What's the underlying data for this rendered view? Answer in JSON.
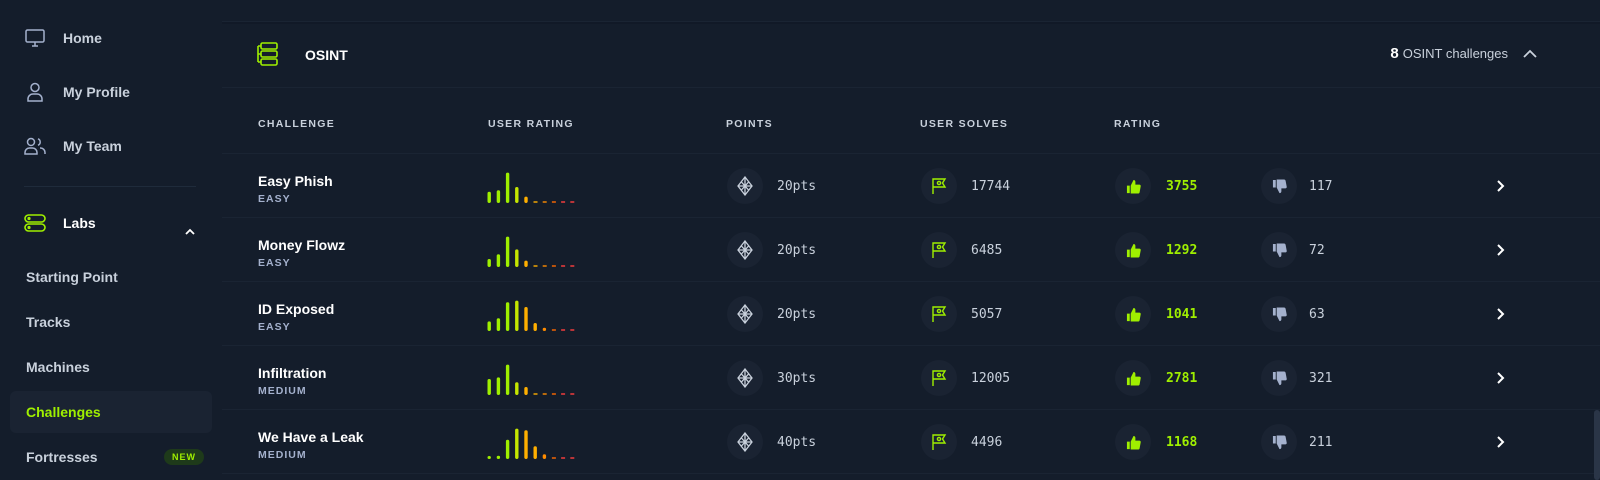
{
  "sidebar": {
    "nav": [
      {
        "label": "Home",
        "icon": "monitor-icon"
      },
      {
        "label": "My Profile",
        "icon": "user-icon"
      },
      {
        "label": "My Team",
        "icon": "team-icon"
      },
      {
        "label": "Labs",
        "icon": "labs-icon"
      }
    ],
    "sub": [
      {
        "label": "Starting Point"
      },
      {
        "label": "Tracks"
      },
      {
        "label": "Machines"
      },
      {
        "label": "Challenges",
        "active": true
      },
      {
        "label": "Fortresses",
        "badge": "NEW"
      }
    ]
  },
  "section": {
    "title": "OSINT",
    "count": "8",
    "count_label": "OSINT challenges"
  },
  "columns": [
    "CHALLENGE",
    "USER RATING",
    "POINTS",
    "USER SOLVES",
    "RATING"
  ],
  "rows": [
    {
      "name": "Easy Phish",
      "difficulty": "EASY",
      "points": "20pts",
      "solves": "17744",
      "likes": "3755",
      "dislikes": "117",
      "bars": [
        0.35,
        0.4,
        0.95,
        0.5,
        0.2,
        0.05,
        0.05,
        0.05,
        0.05,
        0.05
      ]
    },
    {
      "name": "Money Flowz",
      "difficulty": "EASY",
      "points": "20pts",
      "solves": "6485",
      "likes": "1292",
      "dislikes": "72",
      "bars": [
        0.25,
        0.4,
        0.95,
        0.55,
        0.2,
        0.05,
        0.05,
        0.05,
        0.05,
        0.05
      ]
    },
    {
      "name": "ID Exposed",
      "difficulty": "EASY",
      "points": "20pts",
      "solves": "5057",
      "likes": "1041",
      "dislikes": "63",
      "bars": [
        0.3,
        0.4,
        0.9,
        0.95,
        0.75,
        0.25,
        0.1,
        0.05,
        0.05,
        0.05
      ]
    },
    {
      "name": "Infiltration",
      "difficulty": "MEDIUM",
      "points": "30pts",
      "solves": "12005",
      "likes": "2781",
      "dislikes": "321",
      "bars": [
        0.5,
        0.55,
        0.95,
        0.4,
        0.25,
        0.05,
        0.05,
        0.05,
        0.05,
        0.05
      ]
    },
    {
      "name": "We Have a Leak",
      "difficulty": "MEDIUM",
      "points": "40pts",
      "solves": "4496",
      "likes": "1168",
      "dislikes": "211",
      "bars": [
        0.08,
        0.1,
        0.6,
        0.95,
        0.9,
        0.4,
        0.15,
        0.05,
        0.05,
        0.05
      ]
    }
  ],
  "colors": {
    "accent": "#9fef00",
    "bar_colors": [
      "#9fef00",
      "#9fef00",
      "#9fef00",
      "#c5e600",
      "#ffaf00",
      "#ffaf00",
      "#ff8c00",
      "#ff6a00",
      "#ff3e3e",
      "#ff3e3e"
    ]
  }
}
